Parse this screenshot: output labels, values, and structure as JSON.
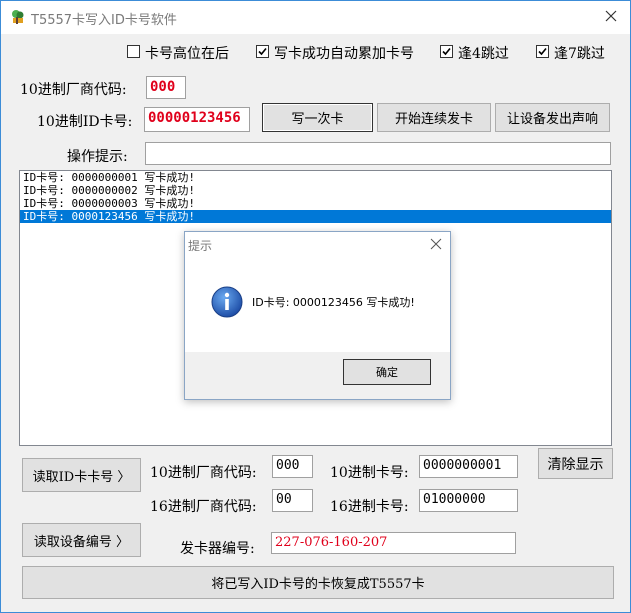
{
  "window": {
    "title": "T5557卡写入ID卡号软件"
  },
  "options": [
    {
      "label": "卡号高位在后",
      "checked": false
    },
    {
      "label": "写卡成功自动累加卡号",
      "checked": true
    },
    {
      "label": "逢4跳过",
      "checked": true
    },
    {
      "label": "逢7跳过",
      "checked": true
    }
  ],
  "write": {
    "vendor_label": "10进制厂商代码:",
    "vendor_value": "000",
    "card_label": "10进制ID卡号:",
    "card_value": "00000123456",
    "write_once": "写一次卡",
    "start_continuous": "开始连续发卡",
    "beep": "让设备发出声响",
    "hint_label": "操作提示:",
    "hint_value": ""
  },
  "log": [
    {
      "text": "ID卡号: 0000000001 写卡成功!",
      "selected": false
    },
    {
      "text": "ID卡号: 0000000002 写卡成功!",
      "selected": false
    },
    {
      "text": "ID卡号: 0000000003 写卡成功!",
      "selected": false
    },
    {
      "text": "ID卡号: 0000123456 写卡成功!",
      "selected": true
    }
  ],
  "read": {
    "read_card_button": "读取ID卡卡号 〉",
    "dec_vendor_label": "10进制厂商代码:",
    "dec_vendor_value": "000",
    "dec_card_label": "10进制卡号:",
    "dec_card_value": "0000000001",
    "hex_vendor_label": "16进制厂商代码:",
    "hex_vendor_value": "00",
    "hex_card_label": "16进制卡号:",
    "hex_card_value": "01000000",
    "clear_button": "清除显示",
    "read_device_button": "读取设备编号 〉",
    "device_label": "发卡器编号:",
    "device_value": "227-076-160-207",
    "restore_button": "将已写入ID卡号的卡恢复成T5557卡"
  },
  "dialog": {
    "title": "提示",
    "message": "ID卡号: 0000123456 写卡成功!",
    "ok": "确定"
  },
  "colors": {
    "accent": "#0078d7",
    "value_red": "#e0001b",
    "window_border": "#3c8cd7"
  }
}
